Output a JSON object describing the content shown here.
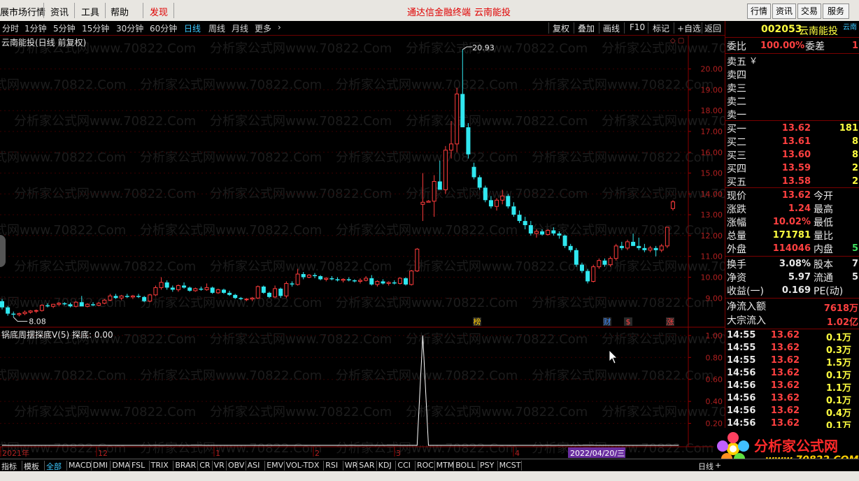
{
  "menu": {
    "items": [
      "展市场行情",
      "资讯",
      "工具",
      "帮助",
      "发现"
    ],
    "center_a": "通达信金融终端",
    "center_b": "云南能投",
    "right": [
      "行情",
      "资讯",
      "交易",
      "服务"
    ]
  },
  "periods": [
    "分时",
    "1分钟",
    "5分钟",
    "15分钟",
    "30分钟",
    "60分钟",
    "日线",
    "周线",
    "月线",
    "更多"
  ],
  "active_period": "日线",
  "tools": [
    "复权",
    "叠加",
    "画线",
    "F10",
    "标记",
    "+自选",
    "返回"
  ],
  "chart_header": "云南能投(日线 前复权)",
  "watermark": "分析家公式网www.70822.Com",
  "chart_data": [
    {
      "type": "candlestick",
      "title": "云南能投(日线 前复权)",
      "yticks": [
        9.0,
        10.0,
        11.0,
        12.0,
        13.0,
        14.0,
        15.0,
        16.0,
        17.0,
        18.0,
        19.0,
        20.0
      ],
      "ylim": [
        7.7,
        21.6
      ],
      "max_label": "20.93",
      "min_label": "8.08",
      "series": [
        {
          "name": "candles",
          "ohlc": [
            [
              8.85,
              8.95,
              8.45,
              8.55
            ],
            [
              8.55,
              8.62,
              8.15,
              8.25
            ],
            [
              8.25,
              8.35,
              8.08,
              8.2
            ],
            [
              8.2,
              8.3,
              8.12,
              8.25
            ],
            [
              8.25,
              8.4,
              8.18,
              8.32
            ],
            [
              8.32,
              8.42,
              8.25,
              8.38
            ],
            [
              8.38,
              8.45,
              8.28,
              8.4
            ],
            [
              8.4,
              8.7,
              8.35,
              8.65
            ],
            [
              8.65,
              8.75,
              8.55,
              8.6
            ],
            [
              8.6,
              8.72,
              8.52,
              8.7
            ],
            [
              8.7,
              8.8,
              8.6,
              8.75
            ],
            [
              8.75,
              8.8,
              8.65,
              8.7
            ],
            [
              8.7,
              8.78,
              8.55,
              8.6
            ],
            [
              8.6,
              8.85,
              8.55,
              8.8
            ],
            [
              8.8,
              9.1,
              8.7,
              8.6
            ],
            [
              8.6,
              8.75,
              8.55,
              8.7
            ],
            [
              8.7,
              8.8,
              8.6,
              8.65
            ],
            [
              8.65,
              8.8,
              8.6,
              8.75
            ],
            [
              8.75,
              8.95,
              8.7,
              8.9
            ],
            [
              8.9,
              9.2,
              8.85,
              9.1
            ],
            [
              9.1,
              9.2,
              8.95,
              9.0
            ],
            [
              9.0,
              9.15,
              8.9,
              9.1
            ],
            [
              9.1,
              9.2,
              9.0,
              9.05
            ],
            [
              9.05,
              9.15,
              8.95,
              9.1
            ],
            [
              9.1,
              9.2,
              9.0,
              9.05
            ],
            [
              9.05,
              9.1,
              8.8,
              8.85
            ],
            [
              8.85,
              9.2,
              8.8,
              9.15
            ],
            [
              9.15,
              9.6,
              9.1,
              9.5
            ],
            [
              9.5,
              10.0,
              9.4,
              9.75
            ],
            [
              9.75,
              9.85,
              9.4,
              9.5
            ],
            [
              9.5,
              9.6,
              9.3,
              9.4
            ],
            [
              9.4,
              9.65,
              9.3,
              9.6
            ],
            [
              9.6,
              9.75,
              9.45,
              9.5
            ],
            [
              9.5,
              9.55,
              9.3,
              9.35
            ],
            [
              9.35,
              9.5,
              9.3,
              9.45
            ],
            [
              9.45,
              9.55,
              9.35,
              9.4
            ],
            [
              9.4,
              9.7,
              9.35,
              9.5
            ],
            [
              9.5,
              9.55,
              9.2,
              9.25
            ],
            [
              9.25,
              9.45,
              9.2,
              9.4
            ],
            [
              9.4,
              9.45,
              9.2,
              9.25
            ],
            [
              9.25,
              9.35,
              9.1,
              9.15
            ],
            [
              9.15,
              9.2,
              8.95,
              9.0
            ],
            [
              9.0,
              9.05,
              8.9,
              8.95
            ],
            [
              8.95,
              9.0,
              8.85,
              8.95
            ],
            [
              8.95,
              9.05,
              8.85,
              9.0
            ],
            [
              9.0,
              9.6,
              8.95,
              9.55
            ],
            [
              9.55,
              9.6,
              9.2,
              9.25
            ],
            [
              9.25,
              9.3,
              9.0,
              9.05
            ],
            [
              9.05,
              9.6,
              9.0,
              9.45
            ],
            [
              9.45,
              9.5,
              9.0,
              9.1
            ],
            [
              9.1,
              9.8,
              9.0,
              9.7
            ],
            [
              9.7,
              9.8,
              9.55,
              9.65
            ],
            [
              9.65,
              10.4,
              9.6,
              10.15
            ],
            [
              10.15,
              10.25,
              9.9,
              10.0
            ],
            [
              10.0,
              10.15,
              9.95,
              10.1
            ],
            [
              10.1,
              10.2,
              9.95,
              10.05
            ],
            [
              10.05,
              10.1,
              9.85,
              9.9
            ],
            [
              9.9,
              10.0,
              9.8,
              9.95
            ],
            [
              9.95,
              10.05,
              9.85,
              9.9
            ],
            [
              9.9,
              10.0,
              9.8,
              9.85
            ],
            [
              9.85,
              9.95,
              9.75,
              9.9
            ],
            [
              9.9,
              10.0,
              9.8,
              9.85
            ],
            [
              9.85,
              9.9,
              9.75,
              9.8
            ],
            [
              9.8,
              9.95,
              9.7,
              9.85
            ],
            [
              9.85,
              10.05,
              9.8,
              9.95
            ],
            [
              9.95,
              10.1,
              9.6,
              9.65
            ],
            [
              9.65,
              9.85,
              9.55,
              9.8
            ],
            [
              9.8,
              9.9,
              9.65,
              9.7
            ],
            [
              9.7,
              9.8,
              9.6,
              9.75
            ],
            [
              9.75,
              9.85,
              9.65,
              9.7
            ],
            [
              9.7,
              10.0,
              9.65,
              9.95
            ],
            [
              9.95,
              10.0,
              9.6,
              9.65
            ],
            [
              9.65,
              10.35,
              9.6,
              10.3
            ],
            [
              10.3,
              11.4,
              10.25,
              11.35
            ],
            [
              13.5,
              15.0,
              12.7,
              13.6
            ],
            [
              13.6,
              13.7,
              13.6,
              13.65
            ],
            [
              13.65,
              14.9,
              12.9,
              14.6
            ],
            [
              14.6,
              15.6,
              14.3,
              14.2
            ],
            [
              14.2,
              16.3,
              14.0,
              16.1
            ],
            [
              16.1,
              17.5,
              15.7,
              16.4
            ],
            [
              16.4,
              19.1,
              16.0,
              18.8
            ],
            [
              18.8,
              20.93,
              18.0,
              17.2
            ],
            [
              17.2,
              17.4,
              15.7,
              15.9
            ],
            [
              15.3,
              15.5,
              14.7,
              14.8
            ],
            [
              14.8,
              14.9,
              14.2,
              14.3
            ],
            [
              14.3,
              14.4,
              13.6,
              13.7
            ],
            [
              13.7,
              13.9,
              13.3,
              13.4
            ],
            [
              13.4,
              13.8,
              13.2,
              13.7
            ],
            [
              13.7,
              14.2,
              13.5,
              13.9
            ],
            [
              13.9,
              14.0,
              13.3,
              13.4
            ],
            [
              13.4,
              13.6,
              12.9,
              13.0
            ],
            [
              13.0,
              13.2,
              12.6,
              12.7
            ],
            [
              12.7,
              12.9,
              12.3,
              12.5
            ],
            [
              12.5,
              12.7,
              12.0,
              12.1
            ],
            [
              12.1,
              12.3,
              11.9,
              12.2
            ],
            [
              12.2,
              12.3,
              12.0,
              12.05
            ],
            [
              12.05,
              12.3,
              12.0,
              12.25
            ],
            [
              12.25,
              12.4,
              12.0,
              12.1
            ],
            [
              12.1,
              12.2,
              11.85,
              12.0
            ],
            [
              12.0,
              12.05,
              11.4,
              11.5
            ],
            [
              11.5,
              11.6,
              11.2,
              11.3
            ],
            [
              11.3,
              11.4,
              10.5,
              10.6
            ],
            [
              10.6,
              10.7,
              10.2,
              10.3
            ],
            [
              10.3,
              10.4,
              9.7,
              9.8
            ],
            [
              9.8,
              10.6,
              9.75,
              10.5
            ],
            [
              10.5,
              10.9,
              10.4,
              10.8
            ],
            [
              10.8,
              10.9,
              10.5,
              10.6
            ],
            [
              10.6,
              11.0,
              10.5,
              10.9
            ],
            [
              10.9,
              11.6,
              10.8,
              11.5
            ],
            [
              11.5,
              11.7,
              11.3,
              11.4
            ],
            [
              11.4,
              11.8,
              11.3,
              11.7
            ],
            [
              11.7,
              12.1,
              11.5,
              11.5
            ],
            [
              11.5,
              11.9,
              11.3,
              11.4
            ],
            [
              11.4,
              11.6,
              11.2,
              11.3
            ],
            [
              11.3,
              11.5,
              11.2,
              11.4
            ],
            [
              11.4,
              11.5,
              11.0,
              11.3
            ],
            [
              11.3,
              11.6,
              11.2,
              11.5
            ],
            [
              11.5,
              12.4,
              11.4,
              12.4
            ],
            [
              13.3,
              13.7,
              13.2,
              13.62
            ]
          ]
        }
      ],
      "event_markers": [
        "榜",
        "财",
        "$",
        "涨"
      ]
    },
    {
      "type": "line",
      "title": "锅底周摆探底V(5) 探底: 0.00",
      "yticks": [
        0.0,
        0.2,
        0.4,
        0.6,
        0.8,
        1.0
      ],
      "ylim": [
        0.0,
        1.05
      ],
      "series": [
        {
          "name": "探底",
          "values_nonzero": [
            {
              "index": 74,
              "value": 1.0
            }
          ],
          "length": 120
        }
      ]
    }
  ],
  "xaxis_labels": [
    "2021年",
    "12",
    "1",
    "2",
    "3",
    "4",
    "2022/04/20/三"
  ],
  "subchart_ticks": [
    "1.00",
    "0.80",
    "0.60",
    "0.40",
    "0.20"
  ],
  "right": {
    "code": "002053",
    "name": "云南能投",
    "corner": "云南",
    "weibi_label": "委比",
    "weibi": "100.00%",
    "weicha_label": "委差",
    "weicha": "1",
    "sell": [
      {
        "label": "卖五",
        "extra": "￥"
      },
      {
        "label": "卖四",
        "extra": ""
      },
      {
        "label": "卖三",
        "extra": ""
      },
      {
        "label": "卖二",
        "extra": ""
      },
      {
        "label": "卖一",
        "extra": ""
      }
    ],
    "buy": [
      {
        "label": "买一",
        "price": "13.62",
        "vol": "181"
      },
      {
        "label": "买二",
        "price": "13.61",
        "vol": "8"
      },
      {
        "label": "买三",
        "price": "13.60",
        "vol": "8"
      },
      {
        "label": "买四",
        "price": "13.59",
        "vol": "2"
      },
      {
        "label": "买五",
        "price": "13.58",
        "vol": "2"
      }
    ],
    "stats": [
      {
        "l1": "现价",
        "v1": "13.62",
        "c1": "red",
        "l2": "今开",
        "v2": ""
      },
      {
        "l1": "涨跌",
        "v1": "1.24",
        "c1": "red",
        "l2": "最高",
        "v2": ""
      },
      {
        "l1": "涨幅",
        "v1": "10.02%",
        "c1": "red",
        "l2": "最低",
        "v2": ""
      },
      {
        "l1": "总量",
        "v1": "171781",
        "c1": "yel",
        "l2": "量比",
        "v2": ""
      },
      {
        "l1": "外盘",
        "v1": "114046",
        "c1": "red",
        "l2": "内盘",
        "v2": "5"
      }
    ],
    "stats2": [
      {
        "l1": "换手",
        "v1": "3.08%",
        "l2": "股本",
        "v2": "7"
      },
      {
        "l1": "净资",
        "v1": "5.97",
        "l2": "流通",
        "v2": "5"
      },
      {
        "l1": "收益(一)",
        "v1": "0.169",
        "l2": "PE(动)",
        "v2": ""
      }
    ],
    "flow": [
      {
        "label": "净流入额",
        "value": "7618万"
      },
      {
        "label": "大宗流入",
        "value": "1.02亿"
      }
    ],
    "ticks": [
      {
        "time": "14:55",
        "price": "13.62",
        "vol": "0.1万"
      },
      {
        "time": "14:55",
        "price": "13.62",
        "vol": "0.3万"
      },
      {
        "time": "14:55",
        "price": "13.62",
        "vol": "1.5万"
      },
      {
        "time": "14:56",
        "price": "13.62",
        "vol": "0.1万"
      },
      {
        "time": "14:56",
        "price": "13.62",
        "vol": "1.1万"
      },
      {
        "time": "14:56",
        "price": "13.62",
        "vol": "0.1万"
      },
      {
        "time": "14:56",
        "price": "13.62",
        "vol": "0.4万"
      },
      {
        "time": "14:56",
        "price": "13.62",
        "vol": "0.1万"
      }
    ]
  },
  "bottom_tabs": [
    "指标",
    "模板",
    "全部",
    "MACD",
    "DMI",
    "DMA",
    "FSL",
    "TRIX",
    "BRAR",
    "CR",
    "VR",
    "OBV",
    "ASI",
    "EMV",
    "VOL-TDX",
    "RSI",
    "WR",
    "SAR",
    "KDJ",
    "CCI",
    "ROC",
    "MTM",
    "BOLL",
    "PSY",
    "MCST"
  ],
  "bottom_right": "日线",
  "logo_text": "分析家公式网",
  "logo_url": "www.70822.COM"
}
